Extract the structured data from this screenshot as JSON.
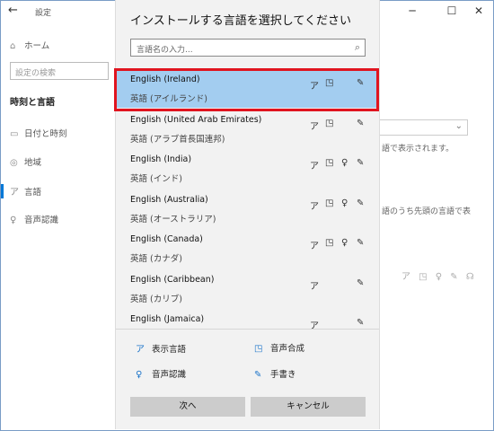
{
  "window": {
    "title": "設定",
    "back_glyph": "←",
    "minimize_glyph": "─",
    "maximize_glyph": "☐",
    "close_glyph": "✕"
  },
  "nav": {
    "home": "ホーム",
    "search_placeholder": "設定の検索",
    "heading": "時刻と言語",
    "items": [
      {
        "icon": "calendar-icon",
        "glyph": "▭",
        "label": "日付と時刻"
      },
      {
        "icon": "globe-icon",
        "glyph": "◎",
        "label": "地域"
      },
      {
        "icon": "language-icon",
        "glyph": "ア",
        "label": "言語"
      },
      {
        "icon": "microphone-icon",
        "glyph": "♀",
        "label": "音声認識"
      }
    ]
  },
  "background": {
    "text1": "語で表示されます。",
    "text2": "語のうち先頭の言語で表",
    "icon_row": "ア ◳ ♀ ✎ ☊"
  },
  "dialog": {
    "title": "インストールする言語を選択してください",
    "search_placeholder": "言語名の入力...",
    "search_icon": "⌕",
    "languages": [
      {
        "en": "English (Ireland)",
        "ja": "英語 (アイルランド)",
        "features": [
          "display",
          "tts",
          "handwriting"
        ],
        "selected": true
      },
      {
        "en": "English (United Arab Emirates)",
        "ja": "英語 (アラブ首長国連邦)",
        "features": [
          "display",
          "tts",
          "handwriting"
        ],
        "selected": false
      },
      {
        "en": "English (India)",
        "ja": "英語 (インド)",
        "features": [
          "display",
          "tts",
          "speech",
          "handwriting"
        ],
        "selected": false
      },
      {
        "en": "English (Australia)",
        "ja": "英語 (オーストラリア)",
        "features": [
          "display",
          "tts",
          "speech",
          "handwriting"
        ],
        "selected": false
      },
      {
        "en": "English (Canada)",
        "ja": "英語 (カナダ)",
        "features": [
          "display",
          "tts",
          "speech",
          "handwriting"
        ],
        "selected": false
      },
      {
        "en": "English (Caribbean)",
        "ja": "英語 (カリブ)",
        "features": [
          "display",
          "handwriting"
        ],
        "selected": false
      },
      {
        "en": "English (Jamaica)",
        "ja": "",
        "features": [
          "display",
          "handwriting"
        ],
        "selected": false
      }
    ],
    "legend": {
      "display": "表示言語",
      "tts": "音声合成",
      "speech": "音声認識",
      "handwriting": "手書き"
    },
    "next_button": "次へ",
    "cancel_button": "キャンセル"
  },
  "colors": {
    "selected_bg": "#a3cdf0",
    "highlight_frame": "#e0141f",
    "accent": "#0078d7"
  }
}
